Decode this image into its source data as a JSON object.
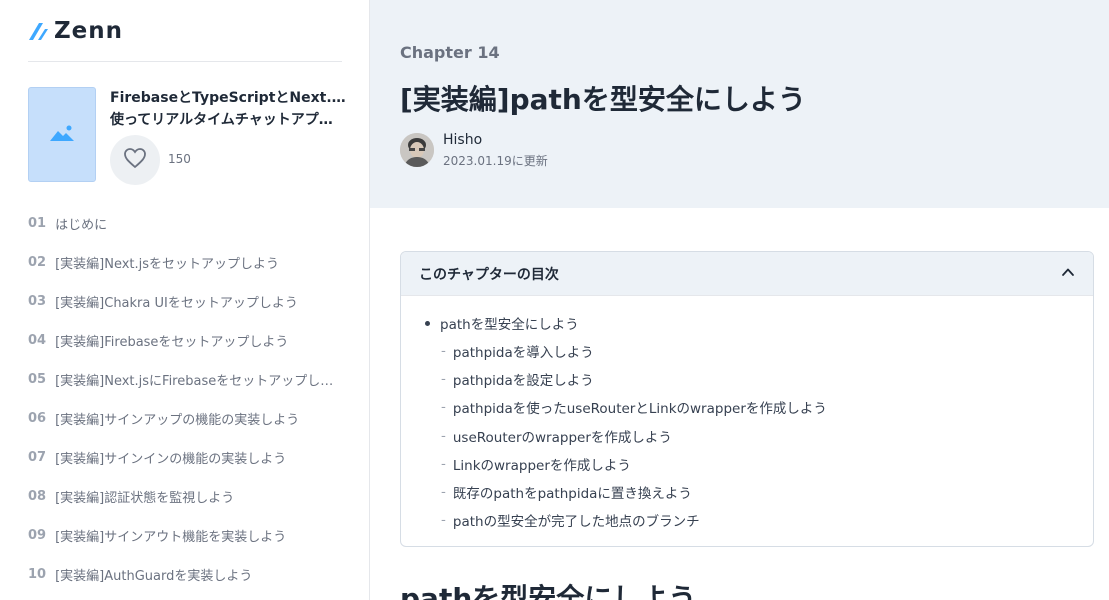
{
  "logo": {
    "text": "Zenn"
  },
  "book": {
    "title_line1": "FirebaseとTypeScriptとNext.jsを",
    "title_line2": "使ってリアルタイムチャットアプ…",
    "likes": "150"
  },
  "sidebar": {
    "chapters": [
      {
        "num": "01",
        "label": "はじめに"
      },
      {
        "num": "02",
        "label": "[実装編]Next.jsをセットアップしよう"
      },
      {
        "num": "03",
        "label": "[実装編]Chakra UIをセットアップしよう"
      },
      {
        "num": "04",
        "label": "[実装編]Firebaseをセットアップしよう"
      },
      {
        "num": "05",
        "label": "[実装編]Next.jsにFirebaseをセットアップし…"
      },
      {
        "num": "06",
        "label": "[実装編]サインアップの機能の実装しよう"
      },
      {
        "num": "07",
        "label": "[実装編]サインインの機能の実装しよう"
      },
      {
        "num": "08",
        "label": "[実装編]認証状態を監視しよう"
      },
      {
        "num": "09",
        "label": "[実装編]サインアウト機能を実装しよう"
      },
      {
        "num": "10",
        "label": "[実装編]AuthGuardを実装しよう"
      }
    ]
  },
  "chapter": {
    "label": "Chapter 14",
    "title": "[実装編]pathを型安全にしよう",
    "author": "Hisho",
    "updated": "2023.01.19に更新"
  },
  "toc": {
    "title": "このチャプターの目次",
    "main_item": "pathを型安全にしよう",
    "sub_items": [
      "pathpidaを導入しよう",
      "pathpidaを設定しよう",
      "pathpidaを使ったuseRouterとLinkのwrapperを作成しよう",
      "useRouterのwrapperを作成しよう",
      "Linkのwrapperを作成しよう",
      "既存のpathをpathpidaに置き換えよう",
      "pathの型安全が完了した地点のブランチ"
    ]
  },
  "content": {
    "heading": "pathを型安全にしよう"
  },
  "colors": {
    "accent": "#3ea8ff",
    "header_bg": "#edf2f7",
    "cover_bg": "#c6dffb"
  },
  "icons": {
    "logo": "zenn-logo-icon",
    "cover": "image-placeholder-icon",
    "like": "heart-icon",
    "collapse": "chevron-up-icon"
  }
}
